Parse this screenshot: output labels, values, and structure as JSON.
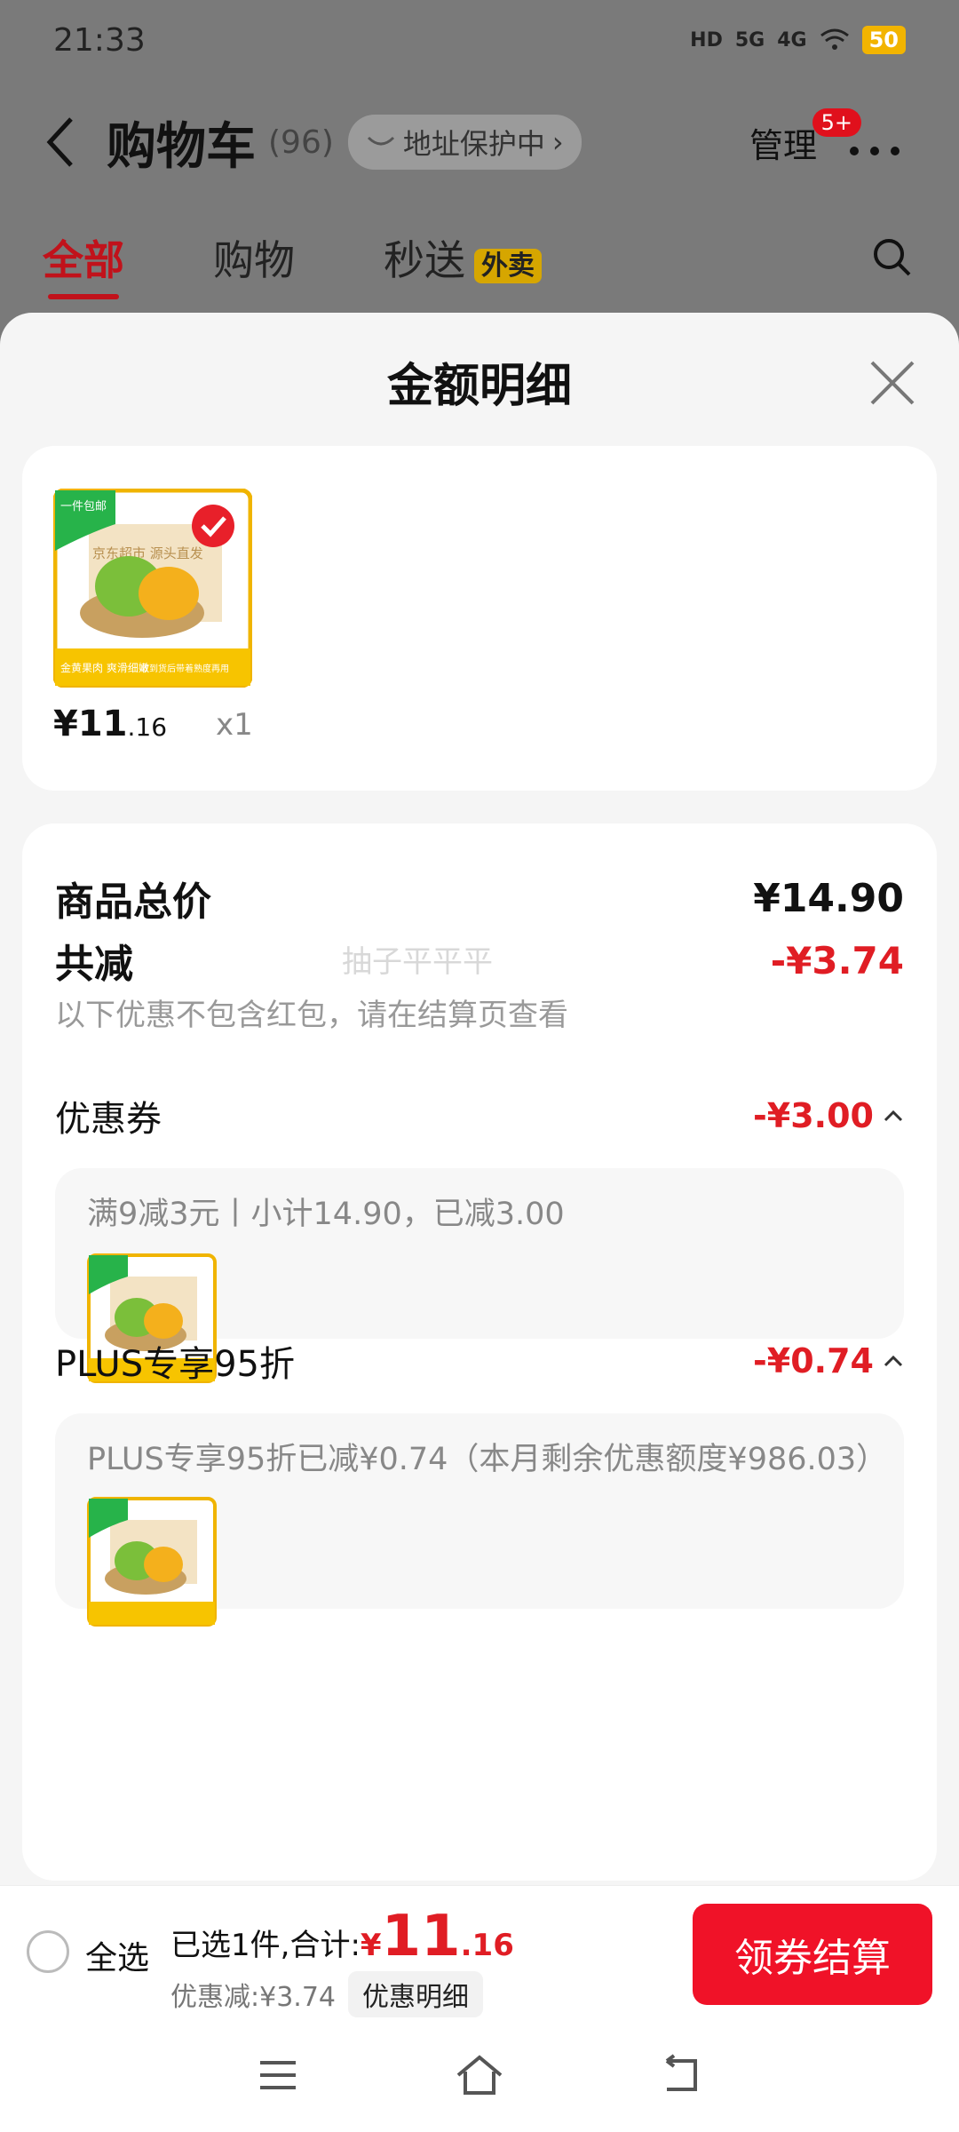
{
  "status_bar": {
    "time": "21:33",
    "hd": "HD",
    "net1": "5G",
    "net2": "4G",
    "battery": "50"
  },
  "header": {
    "title": "购物车",
    "count": "(96)",
    "address_protect": "地址保护中",
    "manage": "管理",
    "more_badge": "5+"
  },
  "tabs": [
    {
      "label": "全部"
    },
    {
      "label": "购物"
    },
    {
      "label": "秒送",
      "badge": "外卖"
    }
  ],
  "sheet": {
    "title": "金额明细",
    "goods": {
      "price_int": "¥11",
      "price_dec": ".16",
      "qty": "x1"
    },
    "total_label": "商品总价",
    "total_value": "¥14.90",
    "reduce_label": "共减",
    "reduce_value": "-¥3.74",
    "reduce_note": "以下优惠不包含红包，请在结算页查看",
    "watermark": "抽子平平平",
    "coupon": {
      "label": "优惠券",
      "value": "-¥3.00",
      "detail": "满9减3元丨小计14.90，已减3.00"
    },
    "plus": {
      "label": "PLUS专享95折",
      "value": "-¥0.74",
      "detail": "PLUS专享95折已减¥0.74（本月剩余优惠额度¥986.03）"
    }
  },
  "product_image": {
    "corner_tag": "一件包邮",
    "brand": "京东超市 源头直发",
    "slogan": "金黄果肉 爽滑细嫩",
    "footer": "收到货后带着熟度再用"
  },
  "bottom_bar": {
    "select_all": "全选",
    "selected_text": "已选1件,合计:",
    "sum_yen": "¥",
    "sum_int": "11",
    "sum_dec": ".16",
    "discount_text": "优惠减:¥3.74",
    "discount_detail_btn": "优惠明细",
    "checkout": "领券结算"
  },
  "colors": {
    "accent_red": "#e01d24",
    "button_red": "#f01228",
    "tab_red": "#c1121b"
  }
}
